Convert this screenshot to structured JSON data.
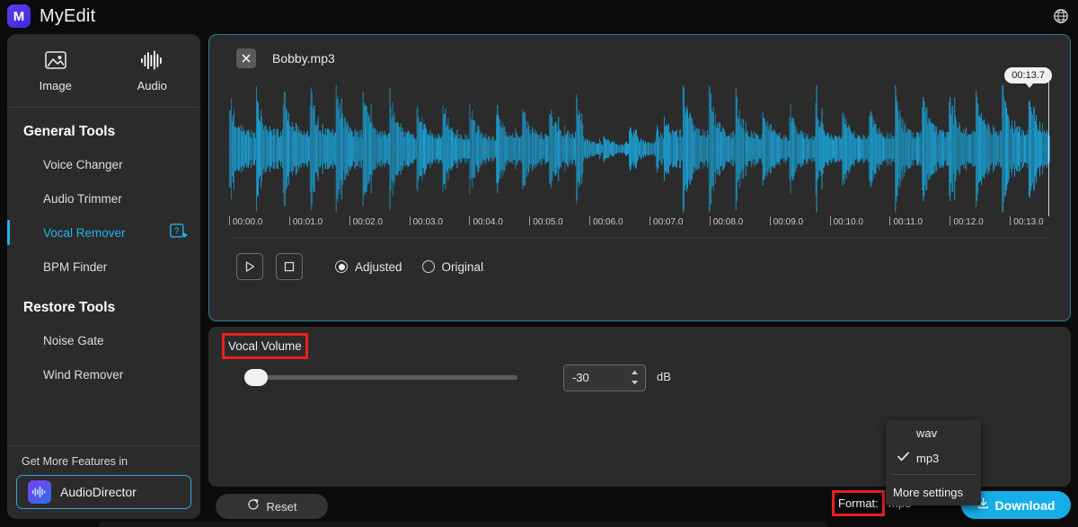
{
  "app": {
    "brand": "MyEdit",
    "logo_glyph": "M",
    "brand_color": "#4a2fe0",
    "accent_color": "#17aee8",
    "highlight_color": "#ef1d1d",
    "globe_icon": "globe-icon"
  },
  "sidebar": {
    "modes": [
      {
        "label": "Image",
        "icon": "image-icon",
        "active": false
      },
      {
        "label": "Audio",
        "icon": "audio-wave-icon",
        "active": true
      }
    ],
    "groups": [
      {
        "title": "General Tools",
        "items": [
          {
            "label": "Voice Changer",
            "active": false
          },
          {
            "label": "Audio Trimmer",
            "active": false
          },
          {
            "label": "Vocal Remover",
            "active": true,
            "badge_icon": "help-video-icon"
          },
          {
            "label": "BPM Finder",
            "active": false
          }
        ]
      },
      {
        "title": "Restore Tools",
        "items": [
          {
            "label": "Noise Gate",
            "active": false
          },
          {
            "label": "Wind Remover",
            "active": false
          }
        ]
      }
    ],
    "features": {
      "caption": "Get More Features in",
      "product": "AudioDirector",
      "product_icon": "audiodirector-icon"
    }
  },
  "editor": {
    "close_icon": "close-icon",
    "file_name": "Bobby.mp3",
    "duration_badge": "00:13.7",
    "ruler_ticks": [
      "00:00.0",
      "00:01.0",
      "00:02.0",
      "00:03.0",
      "00:04.0",
      "00:05.0",
      "00:06.0",
      "00:07.0",
      "00:08.0",
      "00:09.0",
      "00:10.0",
      "00:11.0",
      "00:12.0",
      "00:13.0"
    ],
    "transport": {
      "play_icon": "play-icon",
      "stop_icon": "stop-icon",
      "options": [
        {
          "label": "Adjusted",
          "selected": true
        },
        {
          "label": "Original",
          "selected": false
        }
      ]
    },
    "waveform_color": "#1aa8e0"
  },
  "settings": {
    "vocal_volume_label": "Vocal Volume",
    "vocal_volume_highlighted": true,
    "slider_value_percent": 0,
    "volume_value": "-30",
    "volume_unit": "dB"
  },
  "bottom": {
    "reset_label": "Reset",
    "reset_icon": "reset-icon",
    "format_label": "Format:",
    "format_value": "mp3",
    "format_highlighted": true,
    "download_label": "Download",
    "download_icon": "download-icon"
  },
  "format_menu": {
    "options": [
      {
        "label": "wav",
        "checked": false
      },
      {
        "label": "mp3",
        "checked": true
      }
    ],
    "check_glyph": "✓",
    "more_settings_label": "More settings"
  }
}
